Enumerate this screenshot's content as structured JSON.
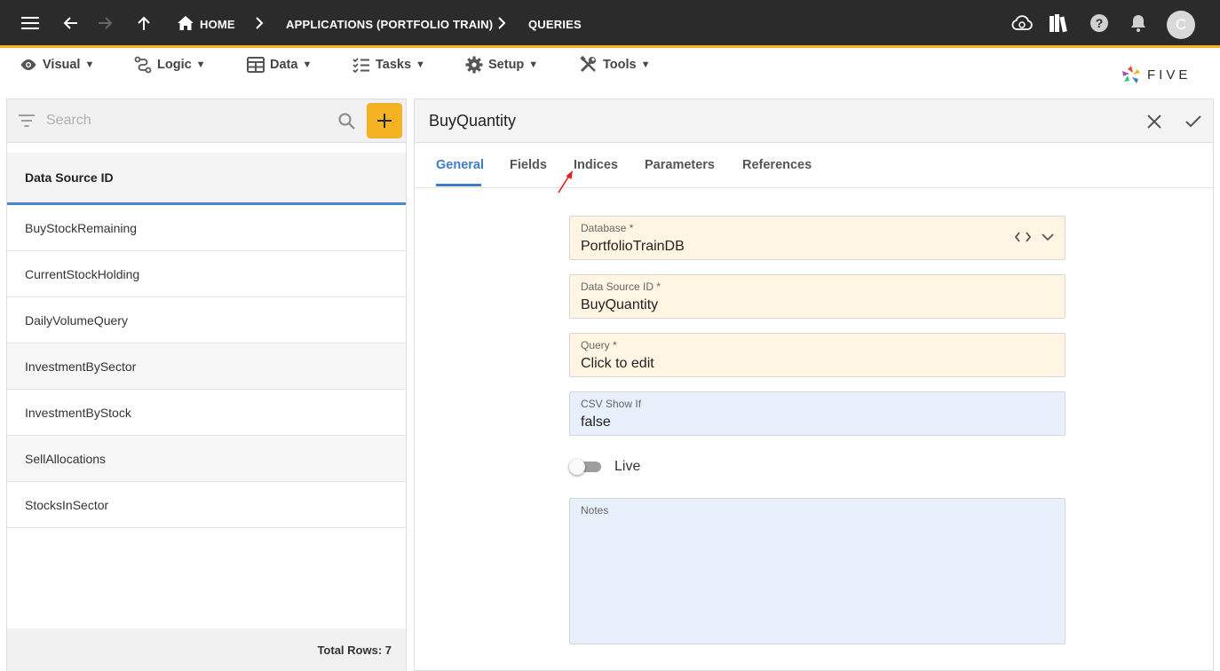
{
  "topbar": {
    "breadcrumb": {
      "home": "HOME",
      "application": "APPLICATIONS (PORTFOLIO TRAIN)",
      "current": "QUERIES"
    },
    "avatar_letter": "C"
  },
  "menu": {
    "items": [
      {
        "label": "Visual",
        "icon": "eye-icon"
      },
      {
        "label": "Logic",
        "icon": "logic-icon"
      },
      {
        "label": "Data",
        "icon": "table-icon"
      },
      {
        "label": "Tasks",
        "icon": "tasks-icon"
      },
      {
        "label": "Setup",
        "icon": "gear-icon"
      },
      {
        "label": "Tools",
        "icon": "tools-icon"
      }
    ],
    "caret": "▼",
    "logo_text": "FIVE"
  },
  "left": {
    "search_placeholder": "Search",
    "column_header": "Data Source ID",
    "rows": [
      "BuyStockRemaining",
      "CurrentStockHolding",
      "DailyVolumeQuery",
      "InvestmentBySector",
      "InvestmentByStock",
      "SellAllocations",
      "StocksInSector"
    ],
    "total_rows": "Total Rows: 7"
  },
  "form": {
    "title": "BuyQuantity",
    "tabs": [
      "General",
      "Fields",
      "Indices",
      "Parameters",
      "References"
    ],
    "active_tab": "General",
    "fields": {
      "database": {
        "label": "Database *",
        "value": "PortfolioTrainDB"
      },
      "data_source_id": {
        "label": "Data Source ID *",
        "value": "BuyQuantity"
      },
      "query": {
        "label": "Query *",
        "value": "Click to edit"
      },
      "csv_show_if": {
        "label": "CSV Show If",
        "value": "false"
      },
      "notes": {
        "label": "Notes",
        "value": ""
      }
    },
    "live_label": "Live",
    "live_on": false
  },
  "colors": {
    "topbar_bg": "#2b2b2b",
    "accent_yellow": "#f5b324",
    "accent_blue": "#3d7cc9",
    "required_field_bg": "#fff5e2",
    "optional_field_bg": "#e7f0fb"
  }
}
